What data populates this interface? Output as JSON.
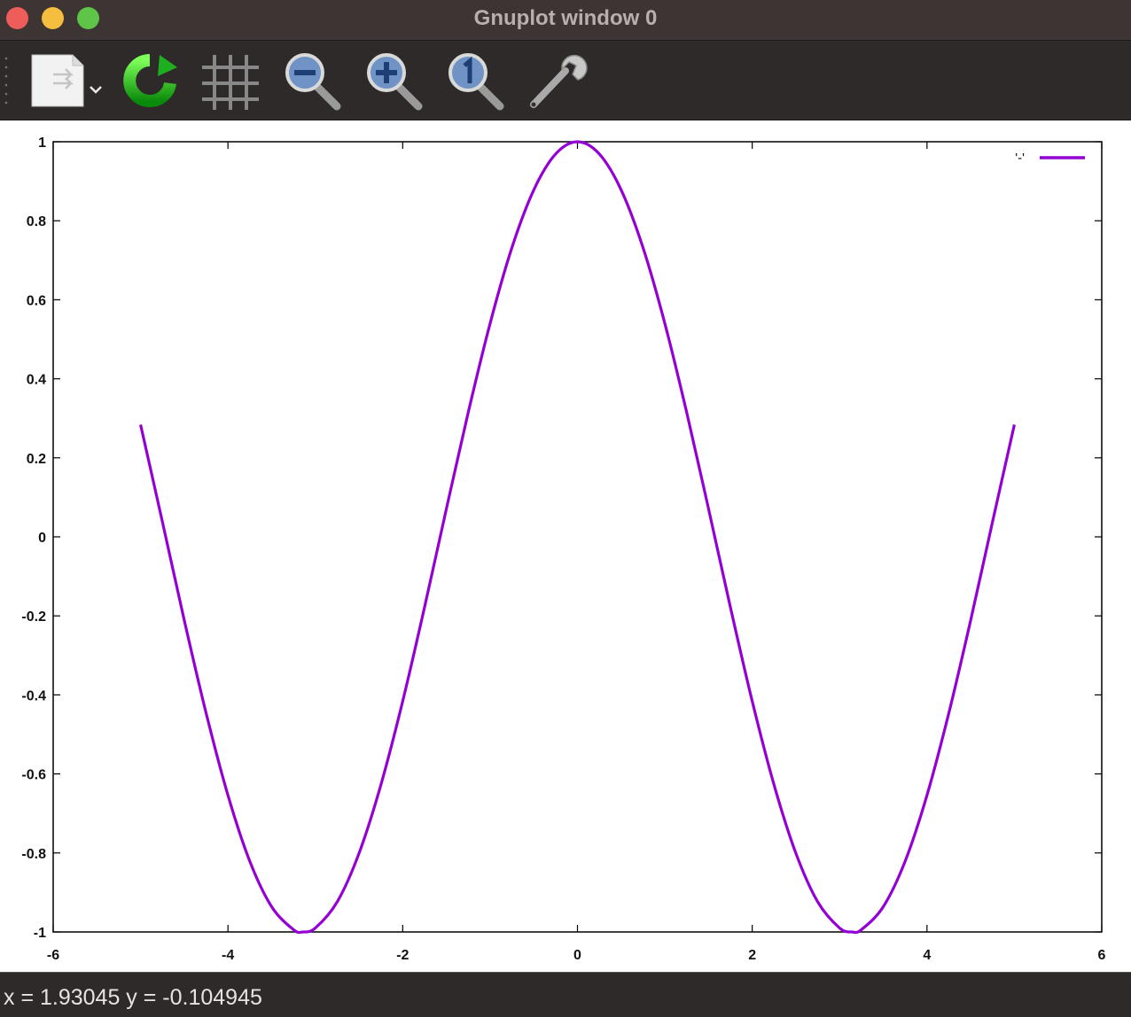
{
  "window": {
    "title": "Gnuplot window 0"
  },
  "toolbar": {
    "tools": [
      {
        "name": "export",
        "icon": "export-menu-icon"
      },
      {
        "name": "replot",
        "icon": "refresh-icon"
      },
      {
        "name": "grid",
        "icon": "grid-icon"
      },
      {
        "name": "zoom-previous",
        "icon": "zoom-out-icon"
      },
      {
        "name": "zoom-next",
        "icon": "zoom-in-icon"
      },
      {
        "name": "zoom-autoscale",
        "icon": "zoom-reset-icon"
      },
      {
        "name": "settings",
        "icon": "wrench-icon"
      }
    ]
  },
  "status": {
    "text": "x = 1.93045 y = -0.104945"
  },
  "colors": {
    "curve": "#9400d3",
    "titlebar": "#3d3533",
    "toolbar": "#2d2a29"
  },
  "chart_data": {
    "type": "line",
    "title": "",
    "xlabel": "",
    "ylabel": "",
    "xlim": [
      -6,
      6
    ],
    "ylim": [
      -1,
      1
    ],
    "xticks": [
      "-6",
      "-4",
      "-2",
      "0",
      "2",
      "4",
      "6"
    ],
    "yticks": [
      "1",
      "0.8",
      "0.6",
      "0.4",
      "0.2",
      "0",
      "-0.2",
      "-0.4",
      "-0.6",
      "-0.8",
      "-1"
    ],
    "grid": false,
    "legend": {
      "position": "top-right",
      "entries": [
        "'-'"
      ]
    },
    "series": [
      {
        "name": "'-'",
        "x": [
          -5.0,
          -4.75,
          -4.5,
          -4.25,
          -4.0,
          -3.75,
          -3.5,
          -3.25,
          -3.14159,
          -3.0,
          -2.75,
          -2.5,
          -2.25,
          -2.0,
          -1.75,
          -1.5,
          -1.25,
          -1.0,
          -0.75,
          -0.5,
          -0.25,
          0.0,
          0.25,
          0.5,
          0.75,
          1.0,
          1.25,
          1.5,
          1.75,
          2.0,
          2.25,
          2.5,
          2.75,
          3.0,
          3.14159,
          3.25,
          3.5,
          3.75,
          4.0,
          4.25,
          4.5,
          4.75,
          5.0
        ],
        "y": [
          0.284,
          0.038,
          -0.211,
          -0.446,
          -0.654,
          -0.821,
          -0.936,
          -0.994,
          -1.0,
          -0.99,
          -0.924,
          -0.801,
          -0.628,
          -0.416,
          -0.178,
          0.071,
          0.315,
          0.54,
          0.732,
          0.878,
          0.969,
          1.0,
          0.969,
          0.878,
          0.732,
          0.54,
          0.315,
          0.071,
          -0.178,
          -0.416,
          -0.628,
          -0.801,
          -0.924,
          -0.99,
          -1.0,
          -0.994,
          -0.936,
          -0.821,
          -0.654,
          -0.446,
          -0.211,
          0.038,
          0.284
        ]
      }
    ]
  }
}
